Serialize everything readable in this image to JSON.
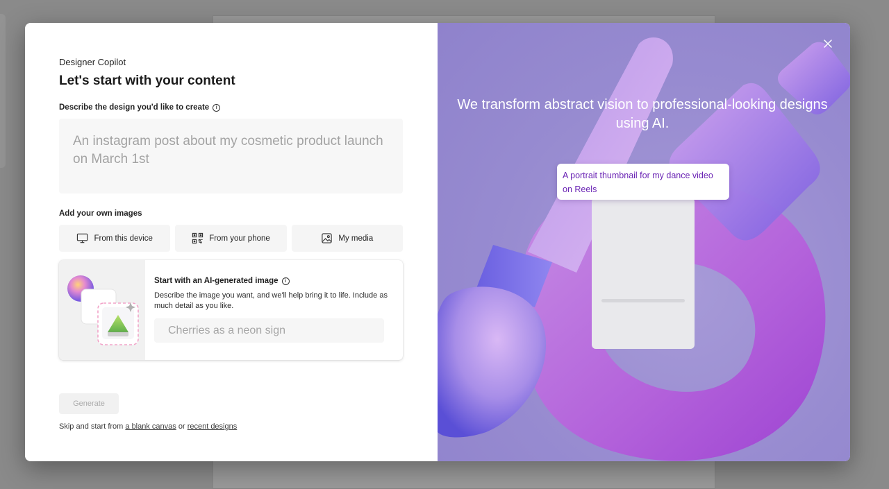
{
  "app": {
    "name": "Designer Copilot",
    "heading": "Let's start with your content"
  },
  "prompt": {
    "label": "Describe the design you'd like to create",
    "placeholder": "An instagram post about my cosmetic product launch on March 1st"
  },
  "images": {
    "label": "Add your own images",
    "sources": [
      {
        "label": "From this device",
        "icon": "monitor-icon"
      },
      {
        "label": "From your phone",
        "icon": "qr-code-icon"
      },
      {
        "label": "My media",
        "icon": "image-icon"
      }
    ]
  },
  "ai_image": {
    "title": "Start with an AI-generated image",
    "description": "Describe the image you want, and we'll help bring it to life. Include as much detail as you like.",
    "placeholder": "Cherries as a neon sign"
  },
  "actions": {
    "generate": "Generate",
    "skip_prefix": "Skip and start from",
    "blank_canvas": "a blank canvas",
    "or": "or",
    "recent_designs": "recent designs"
  },
  "hero": {
    "tagline": "We transform abstract vision to professional-looking designs using AI.",
    "example_prompt": "A portrait thumbnail for my dance video on Reels"
  },
  "colors": {
    "accent_purple": "#6a23b4",
    "hero_background": "#978bd0"
  }
}
